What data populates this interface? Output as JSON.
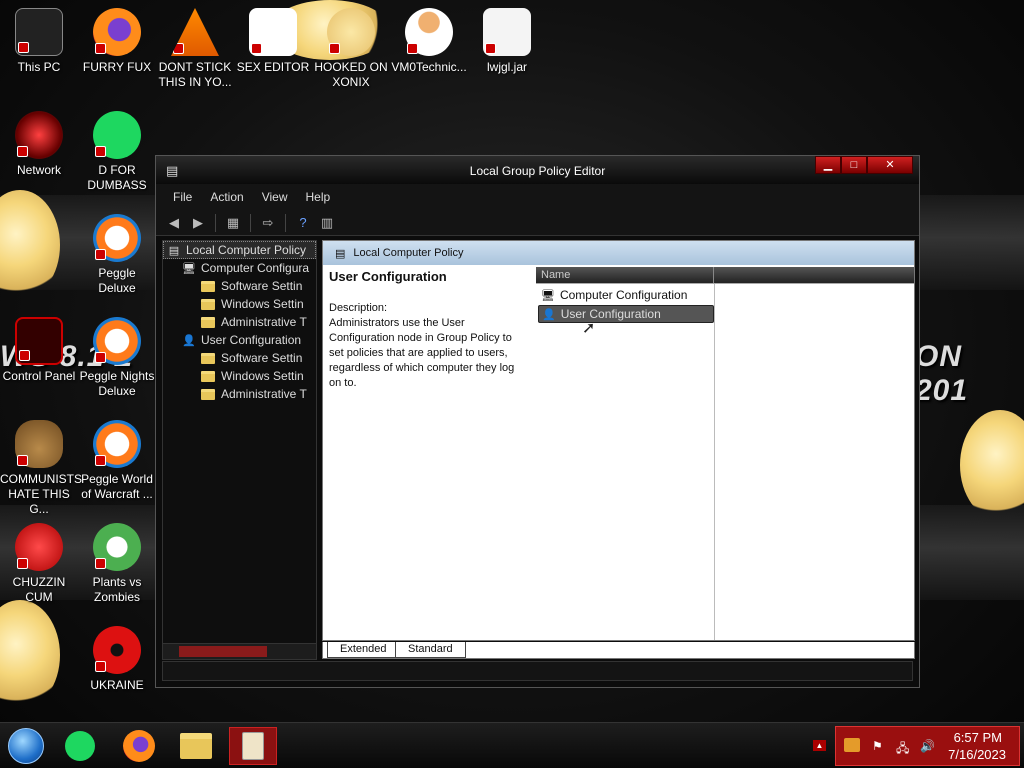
{
  "desktop": {
    "icons": [
      {
        "label": "This PC",
        "glyph": "pc-icon"
      },
      {
        "label": "FURRY FUX",
        "glyph": "firefox-icon"
      },
      {
        "label": "DONT STICK THIS IN YO...",
        "glyph": "vlc-icon"
      },
      {
        "label": "SEX EDITOR",
        "glyph": "hex-editor-icon"
      },
      {
        "label": "HOOKED ON XONIX",
        "glyph": "game-icon"
      },
      {
        "label": "VM0Technic...",
        "glyph": "doctor-icon"
      },
      {
        "label": "lwjgl.jar",
        "glyph": "java-icon"
      },
      {
        "label": "Network",
        "glyph": "network-icon"
      },
      {
        "label": "D FOR DUMBASS",
        "glyph": "spotify-icon"
      },
      {
        "label": "Peggle Deluxe",
        "glyph": "peggle-icon"
      },
      {
        "label": "Control Panel",
        "glyph": "control-panel-icon"
      },
      {
        "label": "Peggle Nights Deluxe",
        "glyph": "peggle-icon"
      },
      {
        "label": "COMMUNISTS HATE THIS G...",
        "glyph": "money-bag-icon"
      },
      {
        "label": "Peggle World of Warcraft ...",
        "glyph": "peggle-icon"
      },
      {
        "label": "CHUZZIN CUM",
        "glyph": "chuzzle-icon"
      },
      {
        "label": "Plants vs Zombies",
        "glyph": "plant-icon"
      },
      {
        "label": "UKRAINE",
        "glyph": "radiation-icon"
      }
    ],
    "wallpaper_left_text": "WS 8.1 L",
    "wallpaper_right_text": "ON 201"
  },
  "window": {
    "title": "Local Group Policy Editor",
    "controls": {
      "minimize": "▁",
      "maximize": "□",
      "close": "✕"
    },
    "menu": [
      "File",
      "Action",
      "View",
      "Help"
    ],
    "tree": {
      "root": "Local Computer Policy",
      "items": [
        {
          "label": "Computer Configura",
          "level": 1,
          "icon": "computer-icon"
        },
        {
          "label": "Software Settin",
          "level": 2,
          "icon": "folder-icon"
        },
        {
          "label": "Windows Settin",
          "level": 2,
          "icon": "folder-icon"
        },
        {
          "label": "Administrative T",
          "level": 2,
          "icon": "folder-icon"
        },
        {
          "label": "User Configuration",
          "level": 1,
          "icon": "user-icon"
        },
        {
          "label": "Software Settin",
          "level": 2,
          "icon": "folder-icon"
        },
        {
          "label": "Windows Settin",
          "level": 2,
          "icon": "folder-icon"
        },
        {
          "label": "Administrative T",
          "level": 2,
          "icon": "folder-icon"
        }
      ]
    },
    "content": {
      "header": "Local Computer Policy",
      "desc_title": "User Configuration",
      "desc_label": "Description:",
      "desc_text": "Administrators use the User Configuration node in Group Policy to set policies that are applied to users, regardless of which computer they log on to.",
      "list_header": {
        "name": "Name"
      },
      "list_items": [
        {
          "label": "Computer Configuration",
          "selected": false
        },
        {
          "label": "User Configuration",
          "selected": true
        }
      ]
    },
    "tabs": [
      "Extended",
      "Standard"
    ]
  },
  "taskbar": {
    "apps": [
      "start-orb-icon",
      "spotify-icon",
      "firefox-icon",
      "file-explorer-icon",
      "group-policy-icon"
    ],
    "clock_time": "6:57 PM",
    "clock_date": "7/16/2023"
  },
  "colors": {
    "accent": "#9a0f0f",
    "content_header": "#b8cfe4",
    "folder": "#e8c65a"
  }
}
